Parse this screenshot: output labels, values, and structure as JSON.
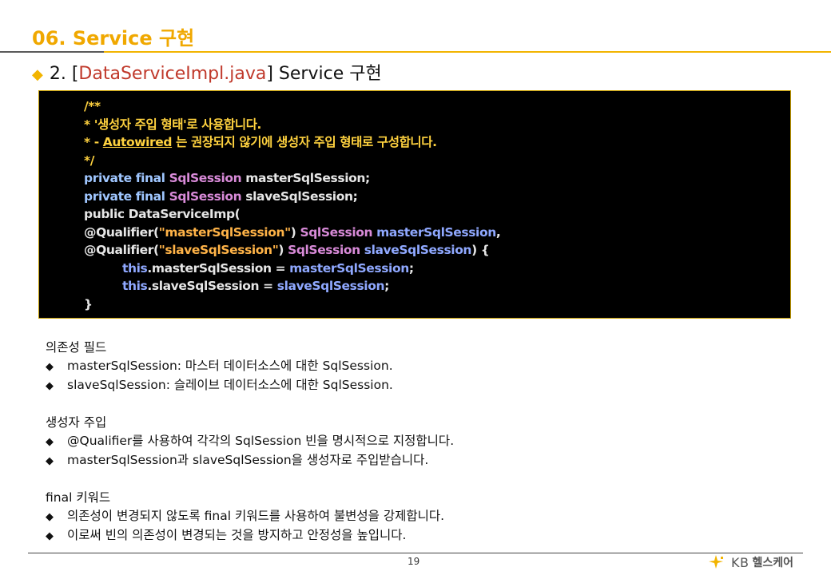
{
  "header": {
    "title": "06. Service 구현",
    "subtitle_prefix": "2. [",
    "subtitle_file": "DataServiceImpl.java",
    "subtitle_suffix": "] Service 구현"
  },
  "code": {
    "l1": "/**",
    "l2": "* '생성자 주입 형태'로 사용합니다.",
    "l3_pre": "* - ",
    "l3_link": "Autowired",
    "l3_post": " 는 권장되지 않기에 생성자 주입 형태로 구성합니다.",
    "l4": "*/",
    "l5_kw": "private final ",
    "l5_type": "SqlSession",
    "l5_name": " masterSqlSession;",
    "l6_kw": "private final ",
    "l6_type": "SqlSession",
    "l6_name": " slaveSqlSession;",
    "l7": "public DataServiceImp(",
    "l8_anno": "@Qualifier(",
    "l8_str": "\"masterSqlSession\"",
    "l8_close": ") ",
    "l8_type": "SqlSession",
    "l8_param": " masterSqlSession",
    "l8_end": ",",
    "l9_anno": "@Qualifier(",
    "l9_str": "\"slaveSqlSession\"",
    "l9_close": ") ",
    "l9_type": "SqlSession",
    "l9_param": " slaveSqlSession",
    "l9_end": ") {",
    "l10_this": "this",
    "l10_field": ".masterSqlSession = ",
    "l10_val": "masterSqlSession",
    "l10_end": ";",
    "l11_this": "this",
    "l11_field": ".slaveSqlSession = ",
    "l11_val": "slaveSqlSession",
    "l11_end": ";",
    "l12": "}"
  },
  "sections": [
    {
      "title": "의존성 필드",
      "bullets": [
        "masterSqlSession: 마스터 데이터소스에 대한 SqlSession.",
        "slaveSqlSession: 슬레이브 데이터소스에 대한 SqlSession."
      ]
    },
    {
      "title": "생성자 주입",
      "bullets": [
        "@Qualifier를 사용하여 각각의 SqlSession 빈을 명시적으로 지정합니다.",
        "masterSqlSession과 slaveSqlSession을 생성자로 주입받습니다."
      ]
    },
    {
      "title": "final 키워드",
      "bullets": [
        "의존성이 변경되지 않도록 final 키워드를 사용하여 불변성을 강제합니다.",
        "이로써 빈의 의존성이 변경되는 것을 방지하고 안정성을 높입니다."
      ]
    }
  ],
  "bullet_glyph": "◆",
  "footer": {
    "page_number": "19",
    "logo_kb": "KB",
    "logo_text": "헬스케어"
  },
  "colors": {
    "accent": "#f0a800",
    "file_name": "#c0392b",
    "code_bg": "#000000"
  }
}
